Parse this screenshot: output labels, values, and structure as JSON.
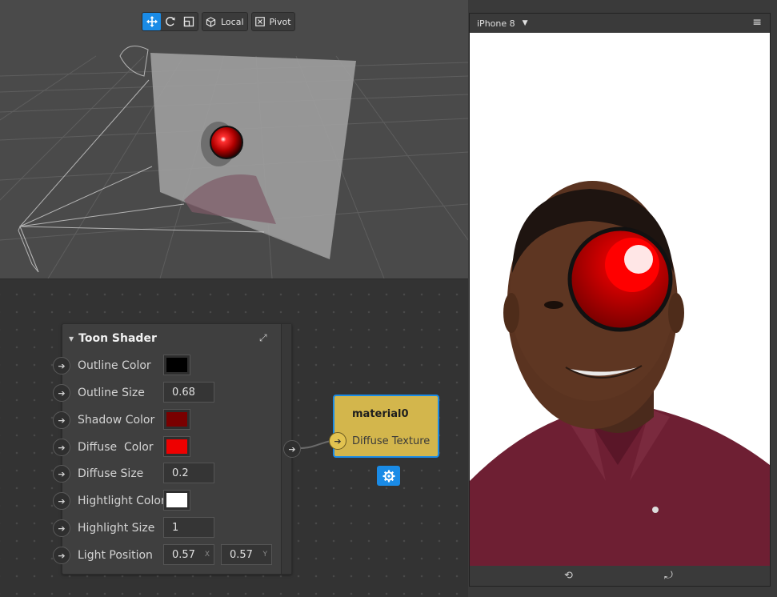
{
  "toolbar": {
    "move_icon": "move-arrows-icon",
    "rotate_icon": "rotate-icon",
    "scale_icon": "scale-icon",
    "local_label": "Local",
    "pivot_label": "Pivot"
  },
  "node": {
    "title": "Toon Shader",
    "properties": [
      {
        "label": "Outline Color",
        "type": "color",
        "color": "#000000"
      },
      {
        "label": "Outline Size",
        "type": "number",
        "value": "0.68"
      },
      {
        "label": "Shadow Color",
        "type": "color",
        "color": "#7a0000"
      },
      {
        "label": "Diffuse  Color",
        "type": "color",
        "color": "#ee0000"
      },
      {
        "label": "Diffuse Size",
        "type": "number",
        "value": "0.2"
      },
      {
        "label": "Hightlight Color",
        "type": "color",
        "color": "#ffffff"
      },
      {
        "label": "Highlight Size",
        "type": "number",
        "value": "1"
      },
      {
        "label": "Light Position",
        "type": "vector",
        "x": "0.57",
        "y": "0.57",
        "x_axis": "X",
        "y_axis": "Y"
      }
    ]
  },
  "material": {
    "title": "material0",
    "slot": "Diffuse Texture"
  },
  "simulator": {
    "device": "iPhone 8"
  },
  "colors": {
    "accent": "#1a8be6",
    "material_node": "#d3b64c"
  }
}
